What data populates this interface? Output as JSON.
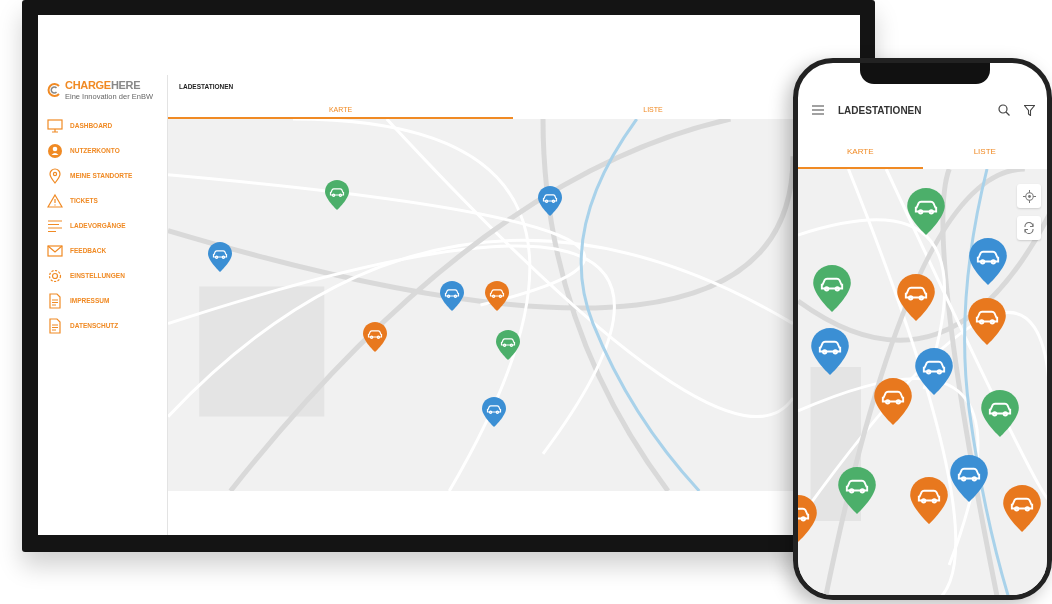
{
  "desktop": {
    "sidebar": {
      "logo": {
        "primary": "CHARGE",
        "secondary": "HERE",
        "tagline": "Eine Innovation der EnBW"
      },
      "items": [
        {
          "label": "DASHBOARD",
          "kind": "monitor"
        },
        {
          "label": "NUTZERKONTO",
          "kind": "account"
        },
        {
          "label": "MEINE STANDORTE",
          "kind": "location"
        },
        {
          "label": "TICKETS",
          "kind": "warning"
        },
        {
          "label": "LADEVORGÄNGE",
          "kind": "list"
        },
        {
          "label": "FEEDBACK",
          "kind": "mail"
        },
        {
          "label": "EINSTELLUNGEN",
          "kind": "settings"
        },
        {
          "label": "IMPRESSUM",
          "kind": "document"
        },
        {
          "label": "DATENSCHUTZ",
          "kind": "document"
        }
      ]
    },
    "title": "LADESTATIONEN",
    "tabs": [
      {
        "label": "KARTE",
        "selected": true
      },
      {
        "label": "LISTE",
        "selected": false
      }
    ],
    "map": {
      "pins": [
        {
          "color": "#4caf6a"
        },
        {
          "color": "#3b8fd4"
        },
        {
          "color": "#3b8fd4"
        },
        {
          "color": "#3b8fd4"
        },
        {
          "color": "#e8781e"
        },
        {
          "color": "#e8781e"
        },
        {
          "color": "#4caf6a"
        },
        {
          "color": "#3b8fd4"
        }
      ]
    }
  },
  "phone": {
    "title": "LADESTATIONEN",
    "tabs": [
      {
        "label": "KARTE",
        "selected": true
      },
      {
        "label": "LISTE",
        "selected": false
      }
    ],
    "map": {
      "pins": [
        {
          "color": "#4caf6a"
        },
        {
          "color": "#3b8fd4"
        },
        {
          "color": "#4caf6a"
        },
        {
          "color": "#e8781e"
        },
        {
          "color": "#e8781e"
        },
        {
          "color": "#3b8fd4"
        },
        {
          "color": "#3b8fd4"
        },
        {
          "color": "#e8781e"
        },
        {
          "color": "#4caf6a"
        },
        {
          "color": "#3b8fd4"
        },
        {
          "color": "#4caf6a"
        },
        {
          "color": "#e8781e"
        },
        {
          "color": "#e8781e"
        },
        {
          "color": "#e8781e"
        }
      ]
    }
  }
}
